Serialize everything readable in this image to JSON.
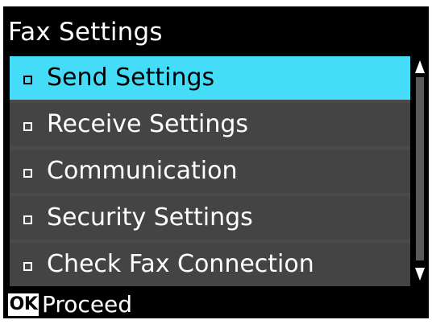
{
  "screen": {
    "title": "Fax Settings"
  },
  "menu": {
    "items": [
      {
        "label": "Send Settings",
        "selected": true
      },
      {
        "label": "Receive Settings",
        "selected": false
      },
      {
        "label": "Communication",
        "selected": false
      },
      {
        "label": "Security Settings",
        "selected": false
      },
      {
        "label": "Check Fax Connection",
        "selected": false
      }
    ]
  },
  "scrollbar": {
    "up_icon": "triangle-up-icon",
    "down_icon": "triangle-down-icon"
  },
  "footer": {
    "ok_key": "OK",
    "action_label": "Proceed"
  },
  "colors": {
    "background": "#000000",
    "item_background": "#444444",
    "selected_background": "#44dcf6",
    "text": "#ffffff",
    "selected_text": "#000000"
  }
}
